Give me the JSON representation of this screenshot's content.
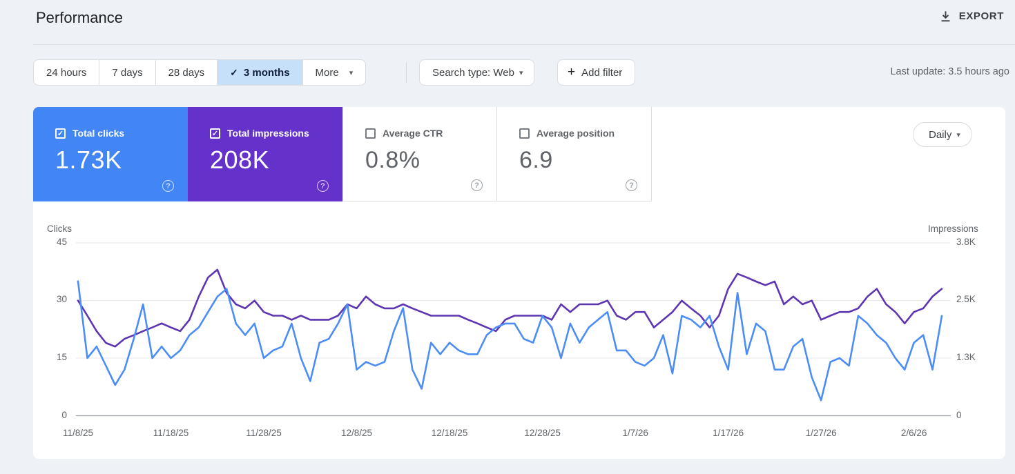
{
  "header": {
    "title": "Performance",
    "export_label": "EXPORT"
  },
  "filters": {
    "ranges": [
      {
        "label": "24 hours",
        "selected": false
      },
      {
        "label": "7 days",
        "selected": false
      },
      {
        "label": "28 days",
        "selected": false
      },
      {
        "label": "3 months",
        "selected": true
      },
      {
        "label": "More",
        "selected": false
      }
    ],
    "check_glyph": "✓",
    "caret_glyph": "▾",
    "search_type_label": "Search type: Web",
    "add_filter_plus": "+",
    "add_filter_label": "Add filter",
    "last_update": "Last update: 3.5 hours ago"
  },
  "metrics": {
    "cards": [
      {
        "label": "Total clicks",
        "value": "1.73K",
        "checked": true,
        "color": "#4285f4"
      },
      {
        "label": "Total impressions",
        "value": "208K",
        "checked": true,
        "color": "#6432ca"
      },
      {
        "label": "Average CTR",
        "value": "0.8%",
        "checked": false,
        "color": "#ffffff"
      },
      {
        "label": "Average position",
        "value": "6.9",
        "checked": false,
        "color": "#ffffff"
      }
    ],
    "help_glyph": "?",
    "granularity_label": "Daily"
  },
  "chart_data": {
    "type": "line",
    "title": "",
    "cadence": "daily",
    "start_date": "11/8/25",
    "end_date": "2/9/26",
    "left_axis_label": "Clicks",
    "right_axis_label": "Impressions",
    "grid": "horizontal-only",
    "legend_position": "none",
    "y_gridlines": [
      {
        "left": "45",
        "right": "3.8K",
        "frac": 1.0
      },
      {
        "left": "30",
        "right": "2.5K",
        "frac": 0.6667
      },
      {
        "left": "15",
        "right": "1.3K",
        "frac": 0.3333
      },
      {
        "left": "0",
        "right": "0",
        "frac": 0.0
      }
    ],
    "x_ticks": [
      {
        "label": "11/8/25",
        "day": 0
      },
      {
        "label": "11/18/25",
        "day": 10
      },
      {
        "label": "11/28/25",
        "day": 20
      },
      {
        "label": "12/8/25",
        "day": 30
      },
      {
        "label": "12/18/25",
        "day": 40
      },
      {
        "label": "12/28/25",
        "day": 50
      },
      {
        "label": "1/7/26",
        "day": 60
      },
      {
        "label": "1/17/26",
        "day": 70
      },
      {
        "label": "1/27/26",
        "day": 80
      },
      {
        "label": "2/6/26",
        "day": 90
      }
    ],
    "series": [
      {
        "name": "Clicks",
        "slug": "clicks-line",
        "color": "#4c8df5",
        "axis": "left",
        "axis_max": 45,
        "values": [
          35,
          15,
          18,
          13,
          8,
          12,
          20,
          29,
          15,
          18,
          15,
          17,
          21,
          23,
          27,
          31,
          33,
          24,
          21,
          24,
          15,
          17,
          18,
          24,
          15,
          9,
          19,
          20,
          24,
          29,
          12,
          14,
          13,
          14,
          22,
          28,
          12,
          7,
          19,
          16,
          19,
          17,
          16,
          16,
          21,
          23,
          24,
          24,
          20,
          19,
          26,
          23,
          15,
          24,
          19,
          23,
          25,
          27,
          17,
          17,
          14,
          13,
          15,
          21,
          11,
          26,
          25,
          23,
          26,
          18,
          12,
          32,
          16,
          24,
          22,
          12,
          12,
          18,
          20,
          10,
          4,
          14,
          15,
          13,
          26,
          24,
          21,
          19,
          15,
          12,
          19,
          21,
          12,
          26
        ]
      },
      {
        "name": "Impressions",
        "slug": "impressions-line",
        "color": "#5e35b1",
        "axis": "right",
        "axis_max": 3800,
        "values": [
          2530,
          2200,
          1860,
          1600,
          1520,
          1690,
          1770,
          1860,
          1940,
          2030,
          1940,
          1860,
          2110,
          2620,
          3040,
          3210,
          2700,
          2450,
          2360,
          2530,
          2280,
          2200,
          2200,
          2110,
          2200,
          2110,
          2110,
          2110,
          2200,
          2450,
          2360,
          2620,
          2450,
          2360,
          2360,
          2450,
          2360,
          2280,
          2200,
          2200,
          2200,
          2200,
          2110,
          2030,
          1940,
          1860,
          2110,
          2200,
          2200,
          2200,
          2200,
          2110,
          2450,
          2280,
          2450,
          2450,
          2450,
          2530,
          2200,
          2110,
          2280,
          2280,
          1940,
          2110,
          2280,
          2530,
          2360,
          2200,
          1940,
          2200,
          2790,
          3120,
          3040,
          2950,
          2870,
          2950,
          2450,
          2620,
          2450,
          2530,
          2110,
          2200,
          2280,
          2280,
          2360,
          2620,
          2790,
          2450,
          2280,
          2030,
          2280,
          2360,
          2620,
          2790
        ]
      }
    ]
  }
}
